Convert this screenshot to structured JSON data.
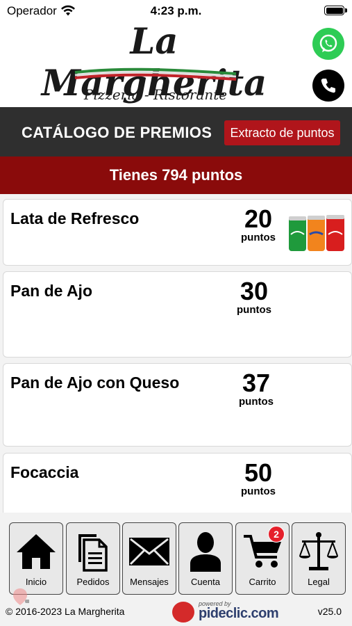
{
  "status_bar": {
    "carrier": "Operador",
    "time": "4:23 p.m."
  },
  "header": {
    "logo_title": "La Margherita",
    "logo_subtitle": "Pizzeria - Ristorante",
    "whatsapp_icon": "whatsapp-icon",
    "phone_icon": "phone-icon"
  },
  "catalog": {
    "title": "CATÁLOGO DE PREMIOS",
    "extract_button": "Extracto de puntos"
  },
  "points_banner": "Tienes 794 puntos",
  "rewards": [
    {
      "name": "Lata de Refresco",
      "points": "20",
      "unit": "puntos"
    },
    {
      "name": "Pan de Ajo",
      "points": "30",
      "unit": "puntos"
    },
    {
      "name": "Pan de Ajo con Queso",
      "points": "37",
      "unit": "puntos"
    },
    {
      "name": "Focaccia",
      "points": "50",
      "unit": "puntos"
    }
  ],
  "nav": [
    {
      "label": "Inicio",
      "icon": "home-icon"
    },
    {
      "label": "Pedidos",
      "icon": "documents-icon"
    },
    {
      "label": "Mensajes",
      "icon": "envelope-icon"
    },
    {
      "label": "Cuenta",
      "icon": "user-icon"
    },
    {
      "label": "Carrito",
      "icon": "cart-icon",
      "badge": "2"
    },
    {
      "label": "Legal",
      "icon": "scales-icon"
    }
  ],
  "footer": {
    "copyright": "© 2016-2023  La Margherita",
    "powered_by": "powered by",
    "brand": "pideclic.com",
    "version": "v25.0"
  },
  "colors": {
    "dark_bar": "#2f2f2f",
    "red_button": "#b0151b",
    "banner_red": "#8a0b0b",
    "whatsapp_green": "#2ecc55"
  }
}
